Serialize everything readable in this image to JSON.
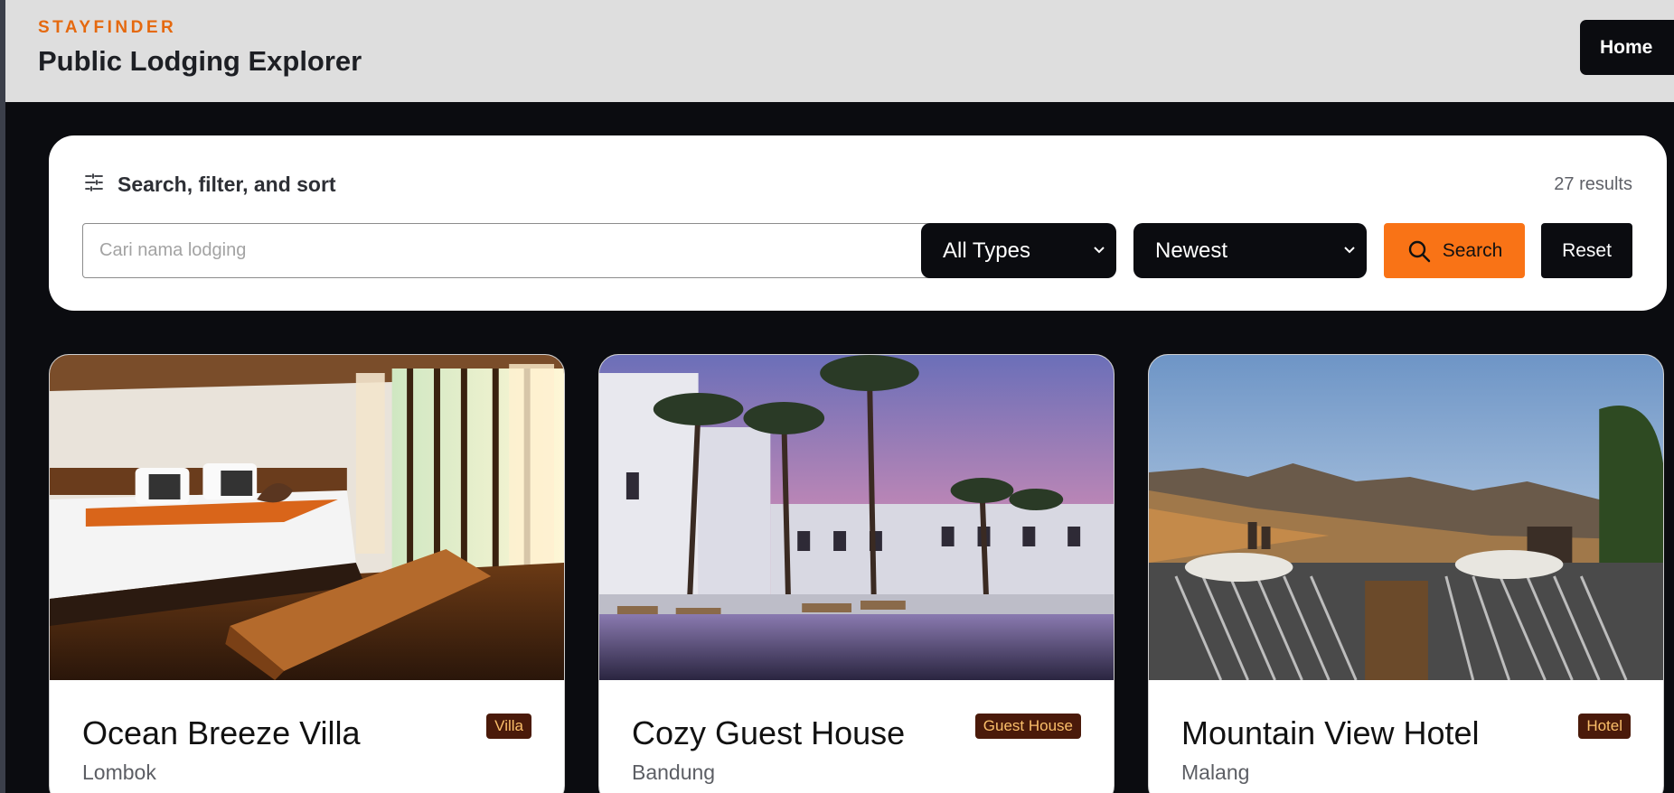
{
  "header": {
    "brand": "STAYFINDER",
    "title": "Public Lodging Explorer",
    "home_label": "Home"
  },
  "search_panel": {
    "title": "Search, filter, and sort",
    "results_text": "27 results",
    "search_placeholder": "Cari nama lodging",
    "type_filter_selected": "All Types",
    "sort_selected": "Newest",
    "search_label": "Search",
    "reset_label": "Reset"
  },
  "cards": [
    {
      "name": "Ocean Breeze Villa",
      "location": "Lombok",
      "type": "Villa",
      "image": "bedroom-villa-photo"
    },
    {
      "name": "Cozy Guest House",
      "location": "Bandung",
      "type": "Guest House",
      "image": "palm-pool-resort-photo"
    },
    {
      "name": "Mountain View Hotel",
      "location": "Malang",
      "type": "Hotel",
      "image": "mountain-terrace-photo"
    }
  ],
  "colors": {
    "brand_accent": "#e5690f",
    "search_button": "#f97316",
    "page_background": "#0b0c10",
    "header_background": "#dedede",
    "badge_background": "#4a1a0a",
    "badge_text": "#fbbf6a"
  }
}
